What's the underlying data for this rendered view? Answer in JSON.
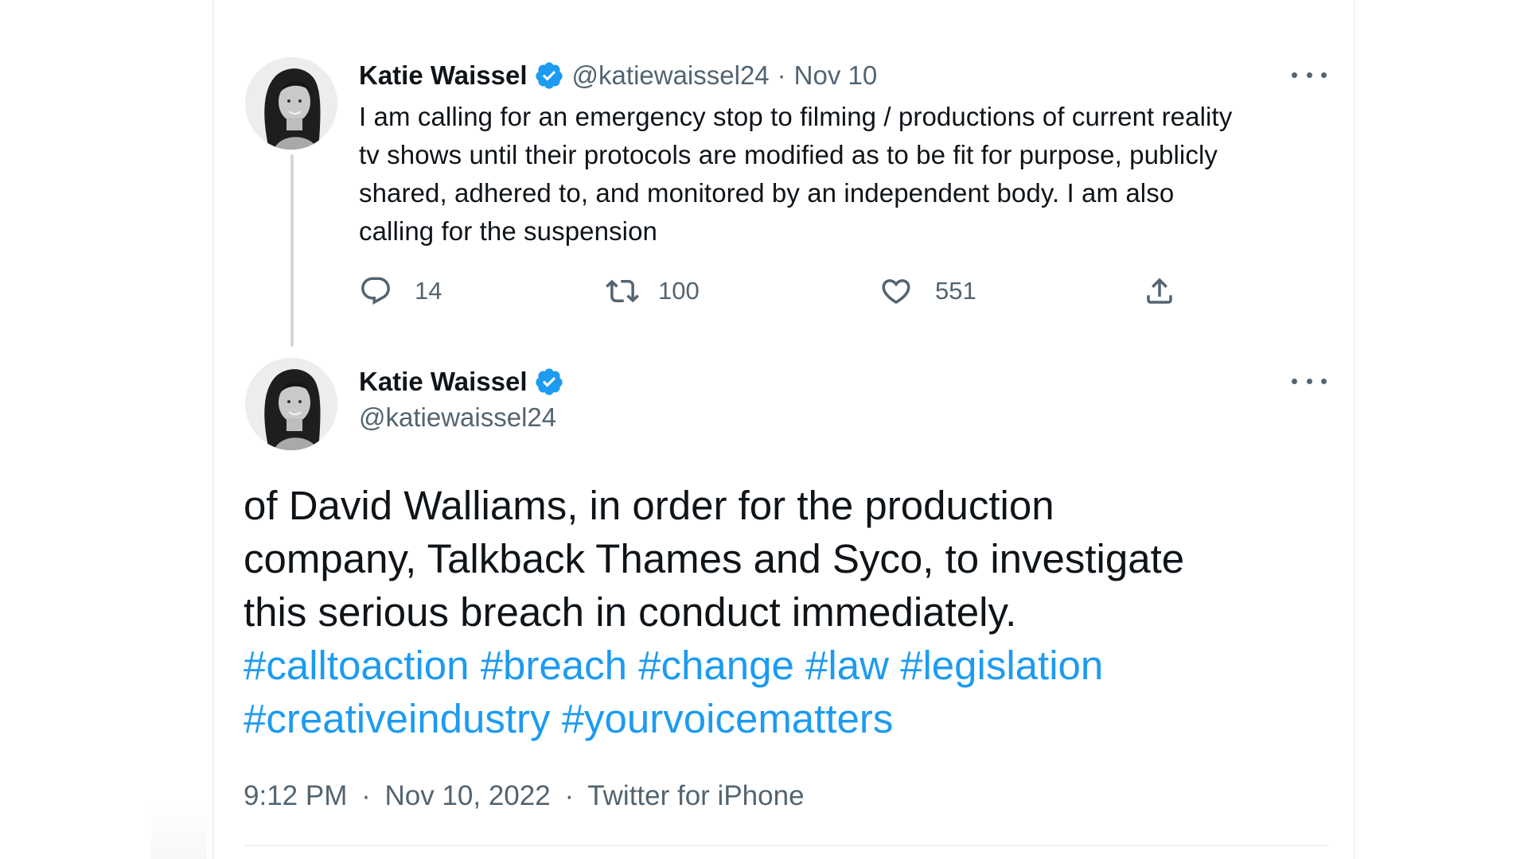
{
  "tweet1": {
    "display_name": "Katie Waissel",
    "handle": "@katiewaissel24",
    "separator": "·",
    "date": "Nov 10",
    "text_lines": [
      "I am calling for an emergency stop to filming / productions of current reality",
      "tv shows until their protocols are modified as to be fit for purpose, publicly",
      "shared, adhered to, and monitored by an independent body. I am also",
      "calling for the suspension"
    ],
    "actions": {
      "replies": "14",
      "retweets": "100",
      "likes": "551"
    }
  },
  "tweet2": {
    "display_name": "Katie Waissel",
    "handle": "@katiewaissel24",
    "text_lines": [
      "of David Walliams, in order for the production",
      "company, Talkback Thames and Syco, to investigate",
      "this serious breach in conduct immediately."
    ],
    "hashtags_line1": [
      "#calltoaction",
      "#breach",
      "#change",
      "#law",
      "#legislation"
    ],
    "hashtags_line2": [
      "#creativeindustry",
      "#yourvoicematters"
    ],
    "time": "9:12 PM",
    "separator": "·",
    "date": "Nov 10, 2022",
    "source": "Twitter for iPhone"
  },
  "icons": {
    "verified": "verified-badge-icon",
    "more": "more-options-icon",
    "reply": "reply-icon",
    "retweet": "retweet-icon",
    "like": "like-heart-icon",
    "share": "share-icon"
  },
  "colors": {
    "verified_blue": "#1d9bf0",
    "hashtag_blue": "#1d9bf0",
    "secondary_text": "#536471",
    "primary_text": "#0f1419",
    "thread_line": "#cfd9de"
  }
}
